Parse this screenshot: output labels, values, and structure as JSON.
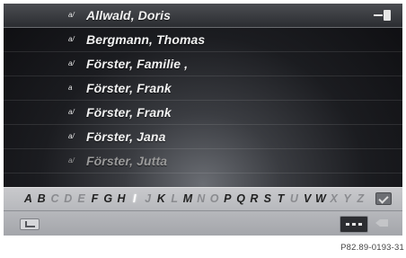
{
  "contacts": [
    {
      "prefix": "a/",
      "name": "Allwald, Doris"
    },
    {
      "prefix": "a/",
      "name": "Bergmann, Thomas"
    },
    {
      "prefix": "a/",
      "name": "Förster, Familie ,"
    },
    {
      "prefix": "a",
      "name": "Förster, Frank"
    },
    {
      "prefix": "a/",
      "name": "Förster, Frank"
    },
    {
      "prefix": "a/",
      "name": "Förster, Jana"
    },
    {
      "prefix": "a/",
      "name": "Förster, Jutta"
    }
  ],
  "selected_index": 0,
  "keyboard": {
    "letters": [
      "A",
      "B",
      "C",
      "D",
      "E",
      "F",
      "G",
      "H",
      "I",
      "J",
      "K",
      "L",
      "M",
      "N",
      "O",
      "P",
      "Q",
      "R",
      "S",
      "T",
      "U",
      "V",
      "W",
      "X",
      "Y",
      "Z"
    ],
    "available": [
      "A",
      "B",
      "F",
      "G",
      "H",
      "K",
      "M",
      "P",
      "Q",
      "R",
      "S",
      "T",
      "V",
      "W"
    ],
    "highlighted": "I"
  },
  "icons": {
    "back_icon": "back-arrow-icon",
    "ok_icon": "ok-check-icon",
    "mode_icon": "input-mode-icon",
    "delete_icon": "delete-backspace-icon",
    "row_action_icon": "plug-icon"
  },
  "caption": "P82.89-0193-31"
}
